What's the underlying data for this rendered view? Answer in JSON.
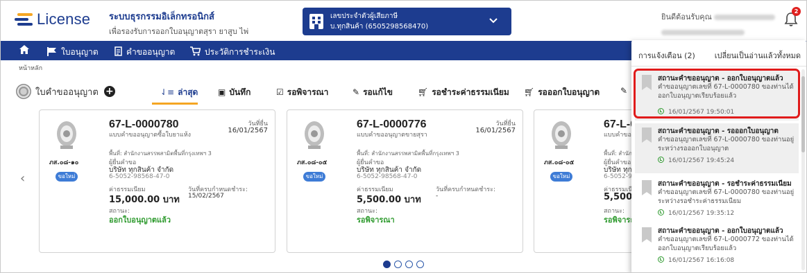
{
  "header": {
    "logo_text": "License",
    "system_title": "ระบบธุรกรรมอิเล็กทรอนิกส์",
    "system_subtitle": "เพื่อรองรับการออกใบอนุญาตสุรา ยาสูบ ไพ่",
    "tax_label": "เลขประจำตัวผู้เสียภาษี",
    "tax_value": "บ.ทุกสินค้า (6505298568470)",
    "welcome_label": "ยินดีต้อนรับคุณ",
    "notification_count": "2"
  },
  "nav": {
    "items": [
      {
        "label": "ใบอนุญาต"
      },
      {
        "label": "คำขออนุญาต"
      },
      {
        "label": "ประวัติการชำระเงิน"
      }
    ]
  },
  "breadcrumb": "หน้าหลัก",
  "list": {
    "title": "ใบคำขออนุญาต",
    "tabs": [
      {
        "label": "ล่าสุด"
      },
      {
        "label": "บันทึก"
      },
      {
        "label": "รอพิจารณา"
      },
      {
        "label": "รอแก้ไข"
      },
      {
        "label": "รอชำระค่าธรรมเนียม"
      },
      {
        "label": "รอออกใบอนุญาต"
      }
    ]
  },
  "cards": [
    {
      "code": "ภส.๐๘-๑๐",
      "new_label": "ขอใหม่",
      "number": "67-L-0000780",
      "type": "แบบคำขออนุญาตซื้อใบยาแห้ง",
      "date_label": "วันที่ยื่น",
      "date": "16/01/2567",
      "area": "พื้นที่: สำนักงานสรรพสามิตพื้นที่กรุงเทพฯ 3",
      "applicant_label": "ผู้ยื่นคำขอ",
      "applicant": "บริษัท ทุกสินค้า จำกัด",
      "tax_id": "6-5052-98568-47-0",
      "fee_label": "ค่าธรรมเนียม",
      "fee": "15,000.00 บาท",
      "pay_label": "วันที่ครบกำหนดชำระ:",
      "pay_value": "15/02/2567",
      "status_label": "สถานะ:",
      "status": "ออกใบอนุญาตแล้ว"
    },
    {
      "code": "ภส.๐๘-๐๕",
      "new_label": "ขอใหม่",
      "number": "67-L-0000776",
      "type": "แบบคำขออนุญาตขายสุรา",
      "date_label": "วันที่ยื่น",
      "date": "16/01/2567",
      "area": "พื้นที่: สำนักงานสรรพสามิตพื้นที่กรุงเทพฯ 3",
      "applicant_label": "ผู้ยื่นคำขอ",
      "applicant": "บริษัท ทุกสินค้า จำกัด",
      "tax_id": "6-5052-98568-47-0",
      "fee_label": "ค่าธรรมเนียม",
      "fee": "5,500.00 บาท",
      "pay_label": "วันที่ครบกำหนดชำระ:",
      "pay_value": "-",
      "status_label": "สถานะ:",
      "status": "รอพิจารณา"
    },
    {
      "code": "ภส.๐๘-๐๕",
      "new_label": "ขอใหม่",
      "number": "67-L-0",
      "type": "แบบคำขอ",
      "date_label": "",
      "date": "",
      "area": "พื้นที่: สำนัก",
      "applicant_label": "ผู้ยื่นคำขอ",
      "applicant": "บริษัท ทุก",
      "tax_id": "6-5052-9",
      "fee_label": "ค่าธรรมเนียม",
      "fee": "5,500.0",
      "pay_label": "",
      "pay_value": "",
      "status_label": "สถานะ:",
      "status": "รอพิจารณ"
    }
  ],
  "notifications": {
    "header": "การแจ้งเตือน (2)",
    "mark_all": "เปลี่ยนเป็นอ่านแล้วทั้งหมด",
    "items": [
      {
        "title": "สถานะคำขออนุญาต - ออกใบอนุญาตแล้ว",
        "body": "คำขออนุญาตเลขที่ 67-L-0000780 ของท่านได้ออกใบอนุญาตเรียบร้อยแล้ว",
        "time": "16/01/2567 19:50:01"
      },
      {
        "title": "สถานะคำขออนุญาต - รอออกใบอนุญาต",
        "body": "คำขออนุญาตเลขที่ 67-L-0000780 ของท่านอยู่ระหว่างรอออกใบอนุญาต",
        "time": "16/01/2567 19:45:24"
      },
      {
        "title": "สถานะคำขออนุญาต - รอชำระค่าธรรมเนียม",
        "body": "คำขออนุญาตเลขที่ 67-L-0000780 ของท่านอยู่ระหว่างรอชำระค่าธรรมเนียม",
        "time": "16/01/2567 19:35:12"
      },
      {
        "title": "สถานะคำขออนุญาต - ออกใบอนุญาตแล้ว",
        "body": "คำขออนุญาตเลขที่ 67-L-0000772 ของท่านได้ออกใบอนุญาตเรียบร้อยแล้ว",
        "time": "16/01/2567 16:16:08"
      }
    ]
  },
  "icons": [
    "home-icon",
    "flag-icon",
    "document-icon",
    "cart-icon",
    "bell-icon",
    "building-icon",
    "chevron-down-icon",
    "chevron-left-icon",
    "plus-icon",
    "sort-icon",
    "save-icon",
    "checkbox-icon",
    "edit-icon",
    "clock-icon",
    "bookmark-icon"
  ],
  "colors": {
    "brand": "#1d3c8f",
    "accent": "#f5a623",
    "success": "#2e9a2e",
    "alert": "#e01b1b"
  }
}
